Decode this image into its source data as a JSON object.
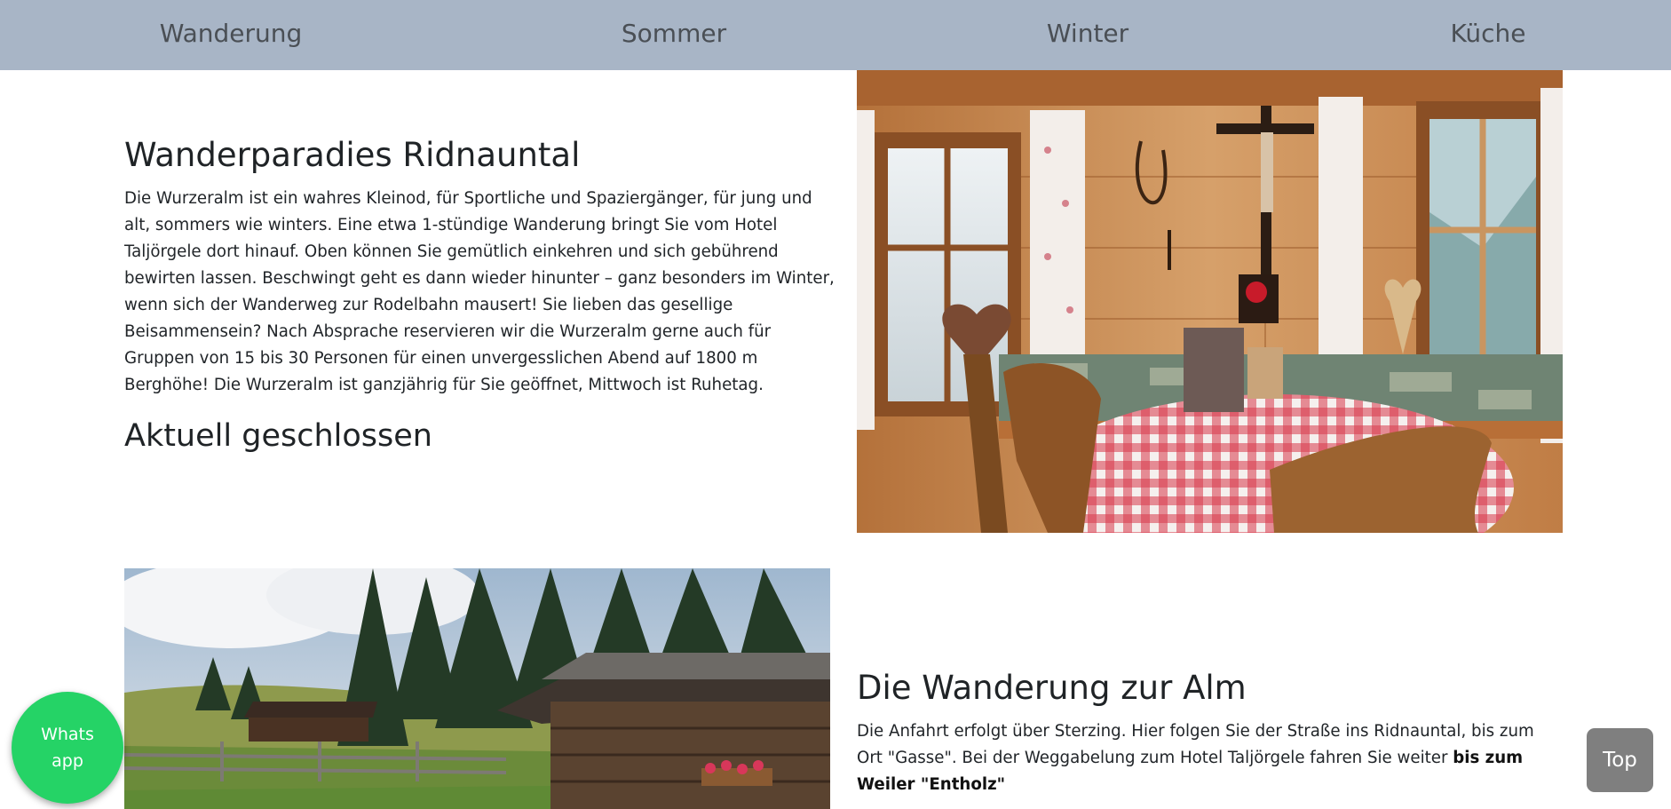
{
  "nav": {
    "items": [
      {
        "label": "Wanderung"
      },
      {
        "label": "Sommer"
      },
      {
        "label": "Winter"
      },
      {
        "label": "Küche"
      }
    ]
  },
  "section1": {
    "title": "Wanderparadies Ridnauntal",
    "text": "Die Wurzeralm ist ein wahres Kleinod, für Sportliche und Spaziergänger, für jung und alt, sommers wie winters. Eine etwa 1-stündige Wanderung bringt Sie vom Hotel Taljörgele dort hinauf. Oben können Sie gemütlich einkehren und sich gebührend bewirten lassen. Beschwingt geht es dann wieder hinunter – ganz besonders im Winter, wenn sich der Wanderweg zur Rodelbahn mausert! Sie lieben das gesellige Beisammensein? Nach Absprache reservieren wir die Wurzeralm gerne auch für Gruppen von 15 bis 30 Personen für einen unvergesslichen Abend auf 1800 m Berghöhe! Die Wurzeralm ist ganzjährig für Sie geöffnet, Mittwoch ist Ruhetag.",
    "status": "Aktuell geschlossen"
  },
  "section2": {
    "title": "Die Wanderung zur Alm",
    "text_plain": "Die Anfahrt erfolgt über Sterzing. Hier folgen Sie der Straße ins Ridnauntal, bis zum Ort \"Gasse\". Bei der Weggabelung zum Hotel Taljörgele fahren Sie weiter ",
    "text_bold": "bis zum Weiler \"Entholz\""
  },
  "buttons": {
    "whatsapp": "Whats app",
    "top": "Top"
  },
  "colors": {
    "nav_bg": "#a8b5c6",
    "whatsapp": "#25d366",
    "top_button": "#7f7f7f"
  },
  "icons": {
    "interior_photo": "stube-interior-photo",
    "exterior_photo": "alm-hut-photo"
  }
}
